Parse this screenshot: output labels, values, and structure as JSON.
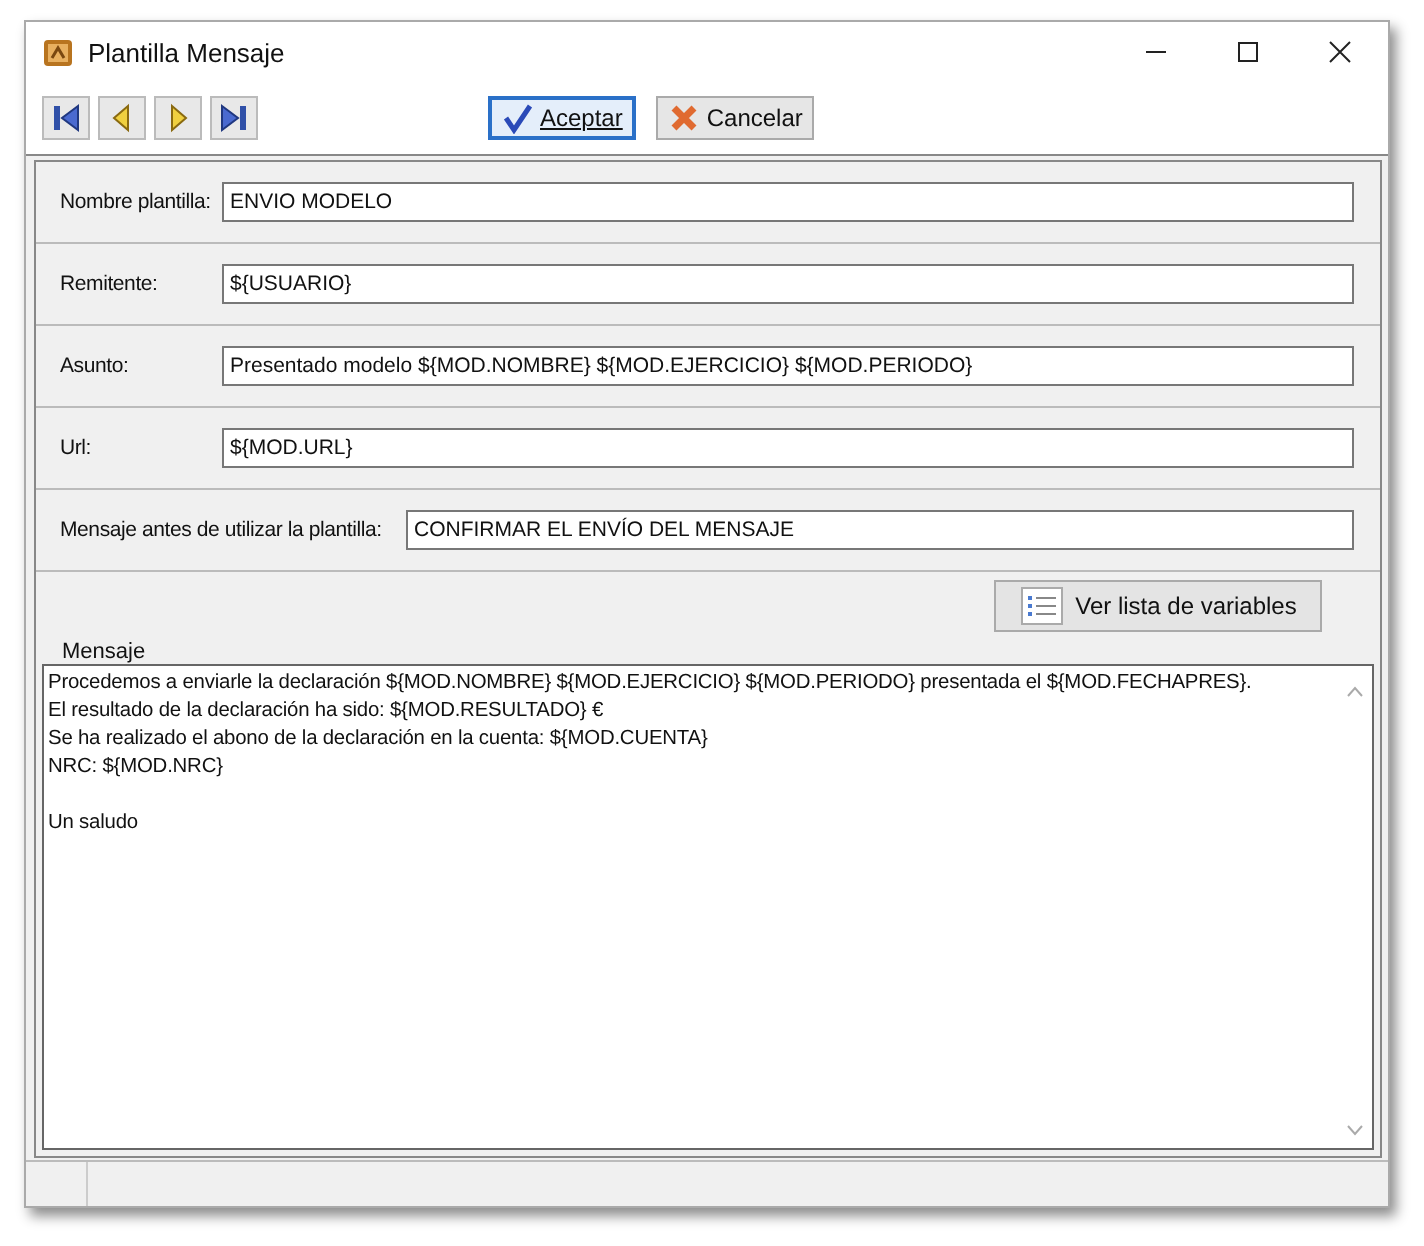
{
  "window": {
    "title": "Plantilla Mensaje"
  },
  "toolbar": {
    "nav_buttons": [
      {
        "kind": "first"
      },
      {
        "kind": "prev"
      },
      {
        "kind": "next"
      },
      {
        "kind": "last"
      }
    ],
    "buttons": [
      {
        "kind": "accept",
        "label": "Aceptar",
        "focused": true
      },
      {
        "kind": "cancel",
        "label": "Cancelar",
        "focused": false
      }
    ]
  },
  "fields": [
    {
      "label": "Nombre plantilla:",
      "value": "ENVIO MODELO",
      "wide_label": false
    },
    {
      "label": "Remitente:",
      "value": "${USUARIO}",
      "wide_label": false
    },
    {
      "label": "Asunto:",
      "value": "Presentado modelo ${MOD.NOMBRE}  ${MOD.EJERCICIO} ${MOD.PERIODO}",
      "wide_label": false
    },
    {
      "label": "Url:",
      "value": "${MOD.URL}",
      "wide_label": false
    },
    {
      "label": "Mensaje antes de utilizar la plantilla:",
      "value": "CONFIRMAR EL ENVÍO DEL MENSAJE",
      "wide_label": true
    }
  ],
  "variables_button": {
    "label": "Ver lista de variables"
  },
  "message": {
    "label": "Mensaje",
    "paragraphs": [
      [
        "Procedemos a enviarle la declaración ${MOD.NOMBRE} ${MOD.EJERCICIO} ${MOD.PERIODO} presentada el ${MOD.FECHAPRES}.",
        "El resultado de la declaración ha sido: ${MOD.RESULTADO} €",
        "Se ha realizado el abono de la declaración en la cuenta: ${MOD.CUENTA}",
        "NRC: ${MOD.NRC}"
      ],
      [
        "Un saludo"
      ]
    ]
  }
}
